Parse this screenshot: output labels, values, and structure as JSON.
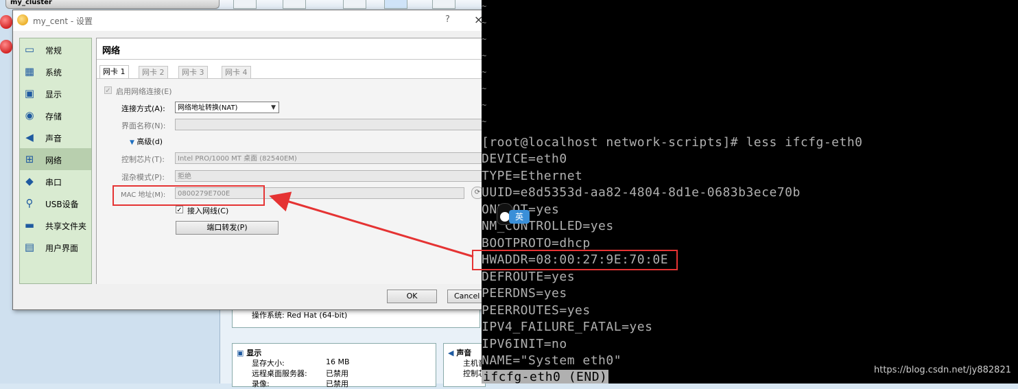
{
  "background": {
    "vm_list_top": "my_cluster",
    "vm_summary": {
      "os_row": "操作系统:   Red Hat (64-bit)",
      "display_header": "显示",
      "display_rows": [
        {
          "label": "显存大小:",
          "value": "16 MB"
        },
        {
          "label": "远程桌面服务器:",
          "value": "已禁用"
        },
        {
          "label": "录像:",
          "value": "已禁用"
        }
      ],
      "audio_header": "声音",
      "audio_rows": [
        "主机音",
        "控制芯"
      ]
    }
  },
  "dialog": {
    "title": "my_cent - 设置",
    "help_label": "?",
    "close_label": "×",
    "categories": [
      {
        "label": "常规",
        "icon": "monitor-icon",
        "glyph": "▭"
      },
      {
        "label": "系统",
        "icon": "chip-icon",
        "glyph": "▦"
      },
      {
        "label": "显示",
        "icon": "display-icon",
        "glyph": "▣"
      },
      {
        "label": "存储",
        "icon": "disk-icon",
        "glyph": "◉"
      },
      {
        "label": "声音",
        "icon": "speaker-icon",
        "glyph": "◀"
      },
      {
        "label": "网络",
        "icon": "network-icon",
        "glyph": "⊞"
      },
      {
        "label": "串口",
        "icon": "serial-icon",
        "glyph": "◆"
      },
      {
        "label": "USB设备",
        "icon": "usb-icon",
        "glyph": "⚲"
      },
      {
        "label": "共享文件夹",
        "icon": "folder-icon",
        "glyph": "▬"
      },
      {
        "label": "用户界面",
        "icon": "window-icon",
        "glyph": "▤"
      }
    ],
    "selected_category": "网络",
    "section_title": "网络",
    "tabs": [
      "网卡 1",
      "网卡 2",
      "网卡 3",
      "网卡 4"
    ],
    "enable_adapter_label": "启用网络连接(E)",
    "attached_label": "连接方式(A):",
    "attached_value": "网络地址转换(NAT)",
    "name_label": "界面名称(N):",
    "name_value": "",
    "advanced_label": "高级(d)",
    "adapter_type_label": "控制芯片(T):",
    "adapter_type_value": "Intel PRO/1000 MT 桌面 (82540EM)",
    "promisc_label": "混杂模式(P):",
    "promisc_value": "拒绝",
    "mac_label": "MAC 地址(M):",
    "mac_value": "0800279E700E",
    "cable_label": "接入网线(C)",
    "port_forward_label": "端口转发(P)",
    "ok_label": "OK",
    "cancel_label": "Cancel"
  },
  "terminal": {
    "tilde": "~",
    "lines": [
      "[root@localhost network-scripts]# less ifcfg-eth0",
      "DEVICE=eth0",
      "TYPE=Ethernet",
      "UUID=e8d5353d-aa82-4804-8d1e-0683b3ece70b",
      "ONBOOT=yes",
      "NM_CONTROLLED=yes",
      "BOOTPROTO=dhcp",
      "HWADDR=08:00:27:9E:70:0E",
      "DEFROUTE=yes",
      "PEERDNS=yes",
      "PEERROUTES=yes",
      "IPV4_FAILURE_FATAL=yes",
      "IPV6INIT=no",
      "NAME=\"System eth0\""
    ],
    "end_marker": "ifcfg-eth0 (END)",
    "ime_label": "英",
    "watermark": "https://blog.csdn.net/jy882821"
  },
  "colors": {
    "highlight": "#e53333",
    "terminal_bg": "#000000",
    "terminal_fg": "#b0b0b0",
    "category_bg": "#d9ebd1"
  }
}
